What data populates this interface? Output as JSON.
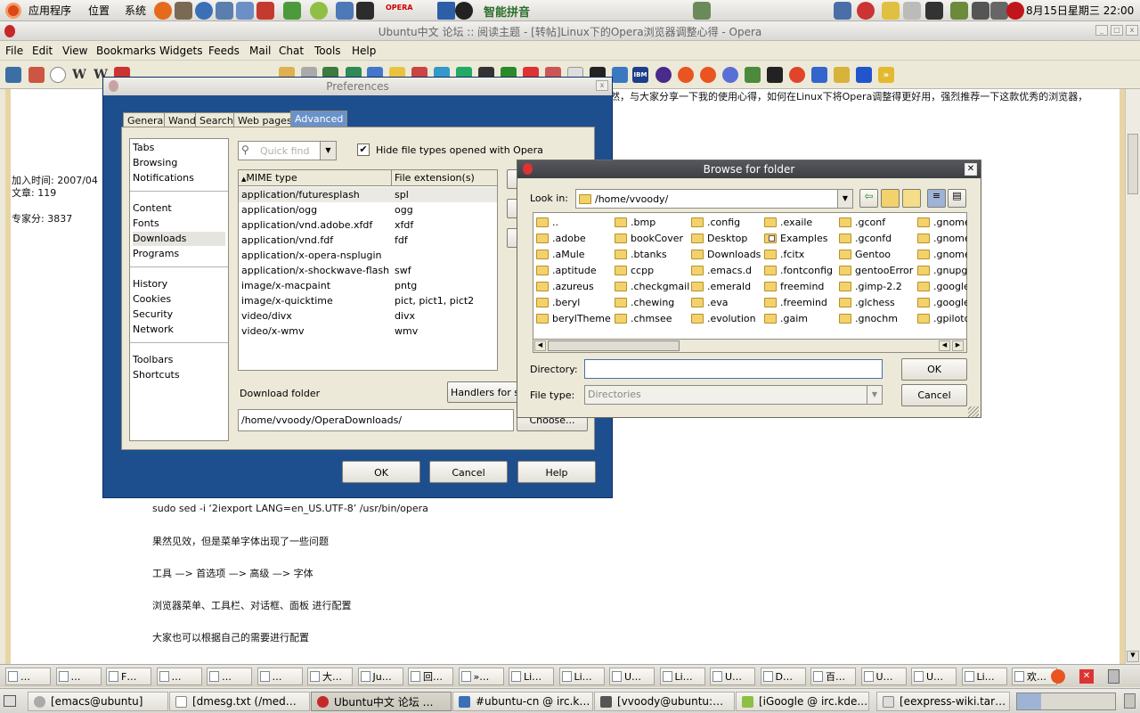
{
  "top_panel": {
    "menus": [
      "应用程序",
      "位置",
      "系统"
    ],
    "im_label": "智能拼音",
    "clock": "8月15日星期三 22:00",
    "launcher_icons": [
      "firefox-icon",
      "gimp-icon",
      "browser-icon",
      "network-icon",
      "editor-icon",
      "app-icon",
      "app-icon",
      "app-icon",
      "app-icon",
      "terminal-icon",
      "opera-icon"
    ]
  },
  "window": {
    "title": "Ubuntu中文 论坛 :: 阅读主题 - [转帖]Linux下的Opera浏览器调整心得 - Opera"
  },
  "menubar": [
    "File",
    "Edit",
    "View",
    "Bookmarks",
    "Widgets",
    "Feeds",
    "Mail",
    "Chat",
    "Tools",
    "Help"
  ],
  "page": {
    "partial_top_text": "然，与大家分享一下我的使用心得，如何在Linux下将Opera调整得更好用，强烈推荐一下这款优秀的浏览器，",
    "join_time": "加入时间: 2007/04",
    "posts": "文章: 119",
    "expert_score": "专家分: 3837",
    "lines": [
      "sudo sed -i ‘2iexport LANG=en_US.UTF-8’ /usr/bin/opera",
      "果然见效，但是菜单字体出现了一些问题",
      "工具 —> 首选项 —> 高级 —> 字体",
      "浏览器菜单、工具栏、对话框、面板 进行配置",
      "大家也可以根据自己的需要进行配置"
    ]
  },
  "preferences": {
    "title": "Preferences",
    "tabs": [
      "General",
      "Wand",
      "Search",
      "Web pages",
      "Advanced"
    ],
    "active_tab": "Advanced",
    "nav_groups": [
      [
        "Tabs",
        "Browsing",
        "Notifications"
      ],
      [
        "Content",
        "Fonts",
        "Downloads",
        "Programs"
      ],
      [
        "History",
        "Cookies",
        "Security",
        "Network"
      ],
      [
        "Toolbars",
        "Shortcuts"
      ]
    ],
    "selected_nav": "Downloads",
    "quick_find_placeholder": "Quick find",
    "hide_types_label": "Hide file types opened with Opera",
    "hide_types_checked": true,
    "columns": [
      "MIME type",
      "File extension(s)"
    ],
    "rows": [
      [
        "application/futuresplash",
        "spl"
      ],
      [
        "application/ogg",
        "ogg"
      ],
      [
        "application/vnd.adobe.xfdf",
        "xfdf"
      ],
      [
        "application/vnd.fdf",
        "fdf"
      ],
      [
        "application/x-opera-nsplugin",
        ""
      ],
      [
        "application/x-shockwave-flash",
        "swf"
      ],
      [
        "image/x-macpaint",
        "pntg"
      ],
      [
        "image/x-quicktime",
        "pict, pict1, pict2"
      ],
      [
        "video/divx",
        "divx"
      ],
      [
        "video/x-wmv",
        "wmv"
      ]
    ],
    "download_folder_label": "Download folder",
    "handlers_button": "Handlers for s",
    "download_folder_value": "/home/vvoody/OperaDownloads/",
    "choose_button": "Choose...",
    "ok": "OK",
    "cancel": "Cancel",
    "help": "Help"
  },
  "browse": {
    "title": "Browse for folder",
    "look_in_label": "Look in:",
    "look_in_value": "/home/vvoody/",
    "folders": [
      [
        "..",
        ".adobe",
        ".aMule",
        ".aptitude",
        ".azureus",
        ".beryl",
        "berylTheme"
      ],
      [
        ".bmp",
        "bookCover",
        ".btanks",
        "ccpp",
        ".checkgmail",
        ".chewing",
        ".chmsee"
      ],
      [
        ".config",
        "Desktop",
        "Downloads",
        ".emacs.d",
        ".emerald",
        ".eva",
        ".evolution"
      ],
      [
        ".exaile",
        "Examples",
        ".fcitx",
        ".fontconfig",
        "freemind",
        ".freemind",
        ".gaim"
      ],
      [
        ".gconf",
        ".gconfd",
        "Gentoo",
        "gentooError",
        ".gimp-2.2",
        ".glchess",
        ".gnochm"
      ],
      [
        ".gnome",
        ".gnome",
        ".gnome",
        ".gnupg",
        ".google",
        ".google",
        ".gpilotd"
      ]
    ],
    "directory_label": "Directory:",
    "directory_value": "",
    "file_type_label": "File type:",
    "file_type_value": "Directories",
    "ok": "OK",
    "cancel": "Cancel"
  },
  "opera_tabs": [
    "…",
    "…",
    "F…",
    "…",
    "…",
    "…",
    "大…",
    "Ju…",
    "回…",
    "»…",
    "Li…",
    "Li…",
    "U…",
    "Li…",
    "U…",
    "D…",
    "百…",
    "U…",
    "U…",
    "Li…",
    "欢…"
  ],
  "taskbar": [
    "[emacs@ubuntu]",
    "[dmesg.txt (/med…",
    "Ubuntu中文 论坛 …",
    "#ubuntu-cn @ irc.k…",
    "[vvoody@ubuntu:…",
    "[iGoogle @ irc.kde.…",
    "[eexpress-wiki.tar…"
  ]
}
